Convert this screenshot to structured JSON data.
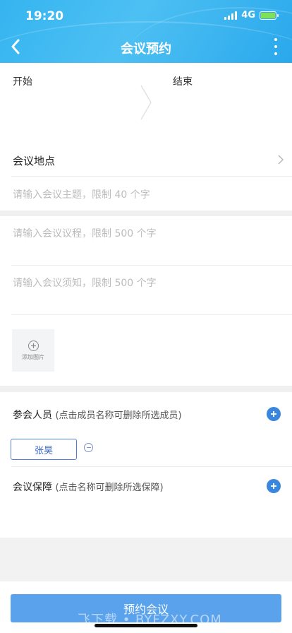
{
  "status_bar": {
    "time": "19:20",
    "network": "4G"
  },
  "header": {
    "title": "会议预约"
  },
  "time_range": {
    "start_label": "开始",
    "end_label": "结束"
  },
  "location": {
    "label": "会议地点"
  },
  "subject": {
    "placeholder": "请输入会议主题，限制 40 个字"
  },
  "agenda": {
    "placeholder": "请输入会议议程，限制 500 个字"
  },
  "notice": {
    "placeholder": "请输入会议须知，限制 500 个字"
  },
  "image_upload": {
    "label": "添加图片"
  },
  "participants": {
    "label": "参会人员",
    "hint": "(点击成员名称可删除所选成员)",
    "members": [
      "张昊"
    ]
  },
  "support": {
    "label": "会议保障",
    "hint": "(点击名称可删除所选保障)"
  },
  "submit": {
    "label": "预约会议"
  },
  "watermark": "飞下载 • BYFZXY.COM",
  "colors": {
    "header": "#35b4f0",
    "accent": "#3a86dc",
    "button": "#5aa3ec"
  }
}
